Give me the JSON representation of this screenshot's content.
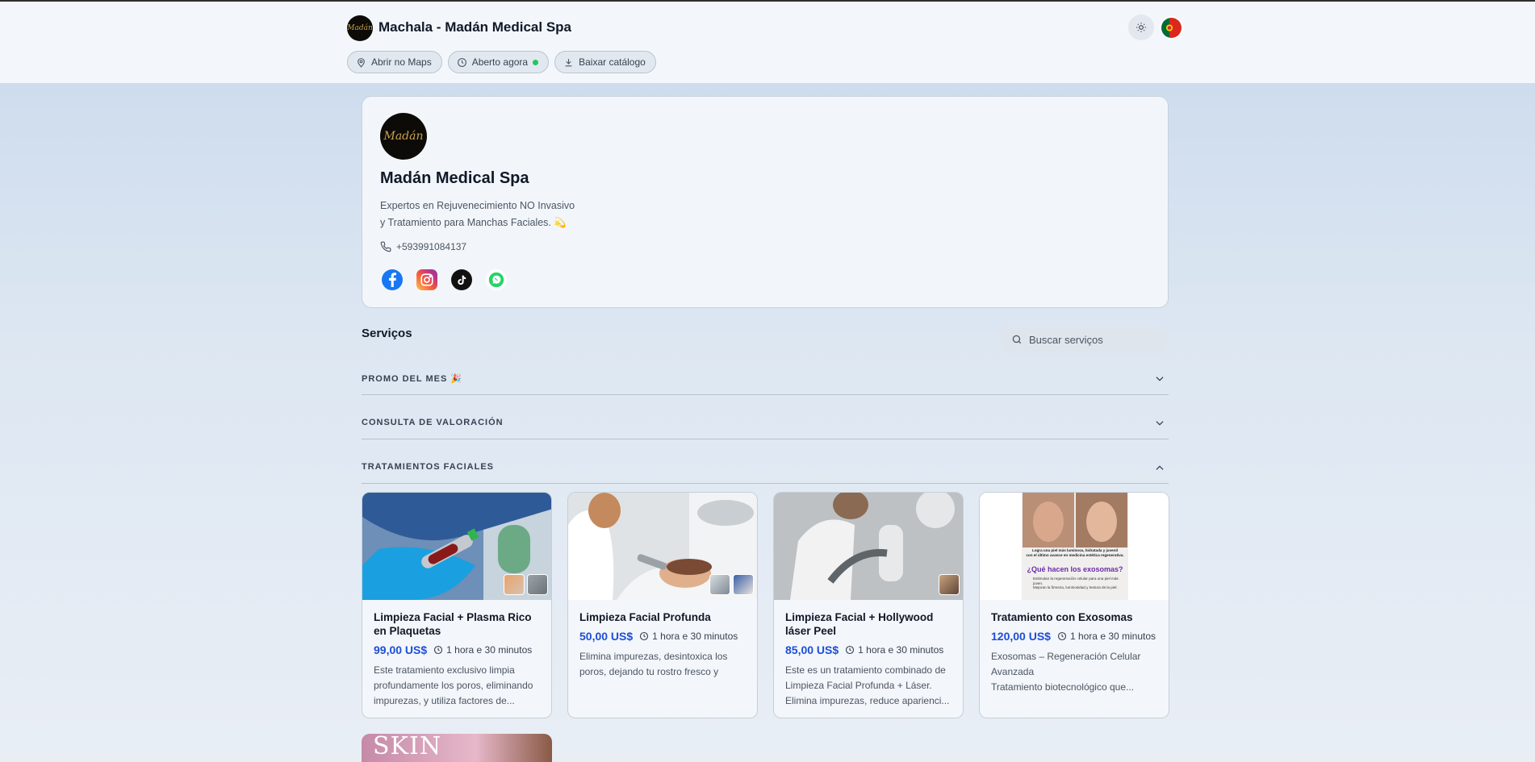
{
  "header": {
    "logo_text": "Madán",
    "title": "Machala - Madán Medical Spa",
    "pills": [
      {
        "label": "Abrir no Maps",
        "icon": "map-pin-icon"
      },
      {
        "label": "Aberto agora",
        "icon": "clock-icon",
        "status": "open"
      },
      {
        "label": "Baixar catálogo",
        "icon": "download-icon"
      }
    ],
    "theme_icon": "sun-icon",
    "language_icon": "portugal-flag-icon"
  },
  "profile": {
    "logo_text": "Madán",
    "name": "Madán Medical Spa",
    "description_line1": "Expertos en Rejuvenecimiento NO Invasivo",
    "description_line2": "y Tratamiento para Manchas Faciales. 💫",
    "phone": "+593991084137",
    "socials": [
      "facebook-icon",
      "instagram-icon",
      "tiktok-icon",
      "whatsapp-icon"
    ]
  },
  "services": {
    "title": "Serviços",
    "search_placeholder": "Buscar serviços",
    "categories": [
      {
        "label": "PROMO DEL MES 🎉",
        "expanded": false
      },
      {
        "label": "CONSULTA DE VALORACIÓN",
        "expanded": false
      },
      {
        "label": "TRATAMIENTOS FACIALES",
        "expanded": true
      }
    ],
    "cards": [
      {
        "title": "Limpieza Facial + Plasma Rico en Plaquetas",
        "price": "99,00 US$",
        "duration": "1 hora e 30 minutos",
        "description": "Este tratamiento exclusivo limpia profundamente los poros, eliminando impurezas, y utiliza factores de..."
      },
      {
        "title": "Limpieza Facial Profunda",
        "price": "50,00 US$",
        "duration": "1 hora e 30 minutos",
        "description": "Elimina impurezas, desintoxica los poros, dejando tu rostro fresco y revitalizado. Ideal para mantener un..."
      },
      {
        "title": "Limpieza Facial + Hollywood láser Peel",
        "price": "85,00 US$",
        "duration": "1 hora e 30 minutos",
        "description": "Este es un tratamiento combinado de Limpieza Facial Profunda + Láser. Elimina impurezas, reduce aparienci..."
      },
      {
        "title": "Tratamiento con Exosomas",
        "price": "120,00 US$",
        "duration": "1 hora e 30 minutos",
        "description_line1": "Exosomas – Regeneración Celular Avanzada",
        "description_line2": "Tratamiento biotecnológico que..."
      }
    ],
    "exosome_poster": {
      "line1": "Logra una piel más luminosa, hidratada y juvenil",
      "line2": "con el último avance en medicina estética regenerativa.",
      "heading": "¿Qué hacen los exosomas?",
      "bullet1": "Estimulan la regeneración celular para una piel más joven.",
      "bullet2": "Mejoran la firmeza, luminosidad y textura de la piel."
    },
    "partial_card_text": "SKIN"
  },
  "colors": {
    "accent_price": "#1d4ed8",
    "open_status": "#22c55e",
    "header_bg": "#f3f7fb"
  }
}
